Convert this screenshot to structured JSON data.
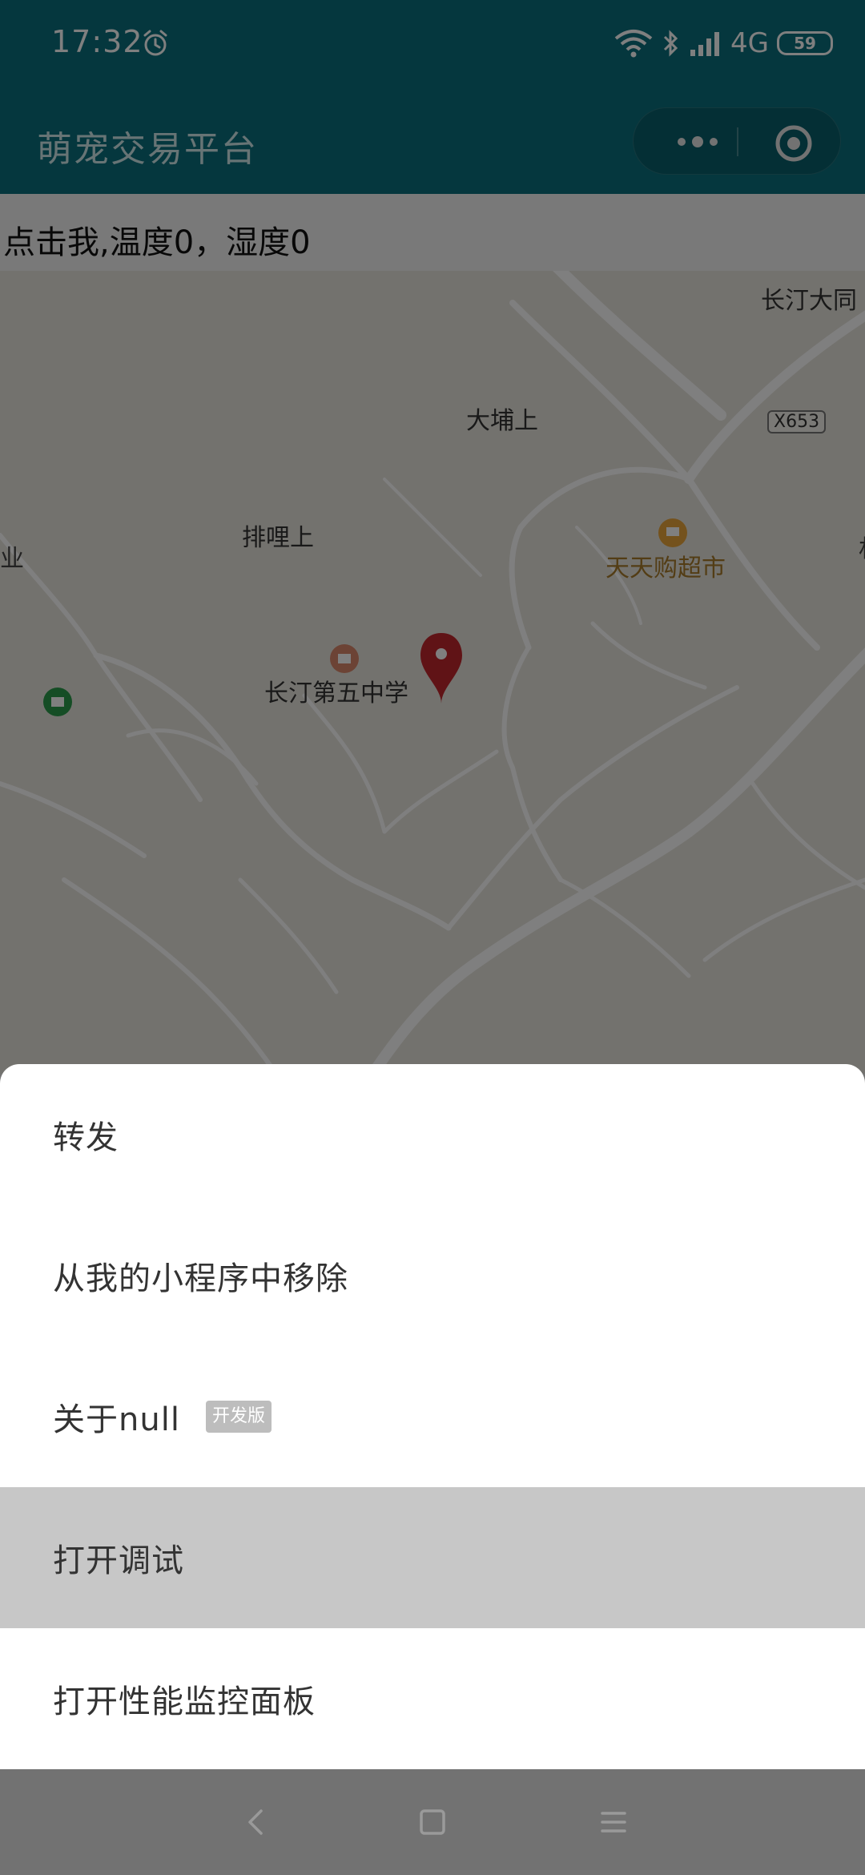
{
  "status_bar": {
    "time": "17:32",
    "network": "4G",
    "battery": "59"
  },
  "header": {
    "title": "萌宠交易平台"
  },
  "sensor_text": "点击我,温度0，湿度0",
  "map": {
    "labels": [
      "长汀大同",
      "大埔上",
      "X653",
      "排哩上",
      "天天购超市",
      "长汀第五中学",
      "业",
      "材"
    ]
  },
  "sheet": {
    "items": [
      {
        "label": "转发"
      },
      {
        "label": "从我的小程序中移除"
      },
      {
        "label": "关于null",
        "badge": "开发版"
      },
      {
        "label": "打开调试"
      },
      {
        "label": "打开性能监控面板"
      }
    ]
  },
  "colors": {
    "header_bg": "#0b6f7c",
    "pin": "#c1272d",
    "poi_orange": "#e8a43a",
    "poi_green": "#2b9a4b"
  }
}
